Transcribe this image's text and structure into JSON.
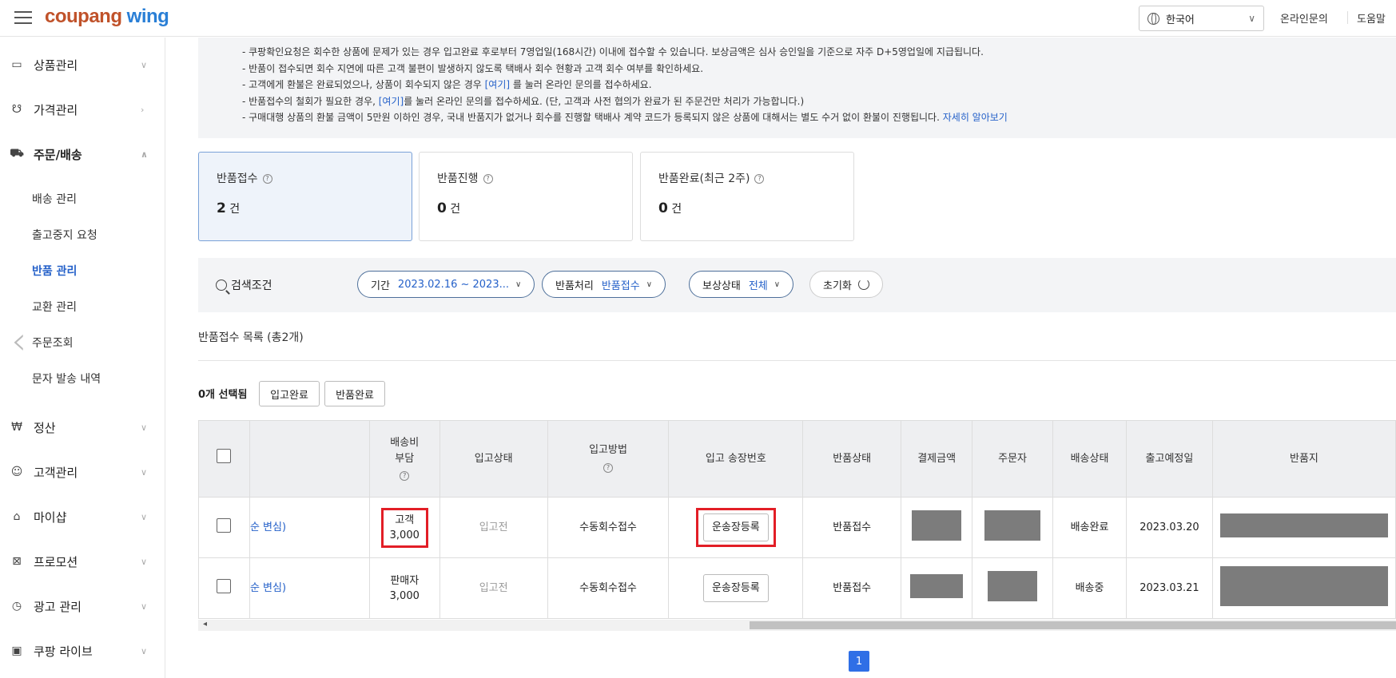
{
  "header": {
    "logo_part1": "coupang",
    "logo_part2": "wing",
    "language": "한국어",
    "online_inquiry": "온라인문의",
    "help": "도움말"
  },
  "sidebar": {
    "items": [
      {
        "label": "상품관리",
        "icon": "box-icon"
      },
      {
        "label": "가격관리",
        "icon": "price-tag-icon"
      },
      {
        "label": "주문/배송",
        "icon": "truck-icon"
      },
      {
        "label": "정산",
        "icon": "won-coin-icon"
      },
      {
        "label": "고객관리",
        "icon": "smile-icon"
      },
      {
        "label": "마이샵",
        "icon": "shop-icon"
      },
      {
        "label": "프로모션",
        "icon": "coupon-icon"
      },
      {
        "label": "광고 관리",
        "icon": "clock-icon"
      },
      {
        "label": "쿠팡 라이브",
        "icon": "live-icon"
      }
    ],
    "sub_items": [
      "배송 관리",
      "출고중지 요청",
      "반품 관리",
      "교환 관리",
      "주문조회",
      "문자 발송 내역"
    ]
  },
  "notice": {
    "line1": "- 쿠팡확인요청은 회수한 상품에 문제가 있는 경우 입고완료 후로부터 7영업일(168시간) 이내에 접수할 수 있습니다. 보상금액은 심사 승인일을 기준으로 자주 D+5영업일에 지급됩니다.",
    "line2": "- 반품이 접수되면 회수 지연에 따른 고객 불편이 발생하지 않도록 택배사 회수 현황과 고객 회수 여부를 확인하세요.",
    "line3a": "- 고객에게 환불은 완료되었으나, 상품이 회수되지 않은 경우 ",
    "line3link": "[여기]",
    "line3b": " 를 눌러 온라인 문의를 접수하세요.",
    "line4a": "- 반품접수의 철회가 필요한 경우, ",
    "line4link": "[여기]",
    "line4b": "를 눌러 온라인 문의를 접수하세요. (단, 고객과 사전 협의가 완료가 된 주문건만 처리가 가능합니다.)",
    "line5a": "- 구매대행 상품의 환불 금액이 5만원 이하인 경우, 국내 반품지가 없거나 회수를 진행할 택배사 계약 코드가 등록되지 않은 상품에 대해서는 별도 수거 없이 환불이 진행됩니다. ",
    "line5link": "자세히 알아보기"
  },
  "cards": [
    {
      "title": "반품접수",
      "count": "2",
      "unit": "건"
    },
    {
      "title": "반품진행",
      "count": "0",
      "unit": "건"
    },
    {
      "title": "반품완료(최근 2주)",
      "count": "0",
      "unit": "건"
    }
  ],
  "search": {
    "label": "검색조건",
    "period_label": "기간",
    "period_value": "2023.02.16 ~ 2023...",
    "process_label": "반품처리",
    "process_value": "반품접수",
    "comp_label": "보상상태",
    "comp_value": "전체",
    "reset": "초기화"
  },
  "list": {
    "title": "반품접수 목록 (총2개)",
    "selected": "0개 선택됨",
    "btn_receive": "입고완료",
    "btn_return_done": "반품완료"
  },
  "table": {
    "headers": [
      "배송비부담",
      "입고상태",
      "입고방법",
      "입고 송장번호",
      "반품상태",
      "결제금액",
      "주문자",
      "배송상태",
      "출고예정일",
      "반품지"
    ],
    "rows": [
      {
        "reason": "순 변심)",
        "payer": "고객",
        "fee": "3,000",
        "in_status": "입고전",
        "in_method": "수동회수접수",
        "invoice_btn": "운송장등록",
        "return_status": "반품접수",
        "ship_status": "배송완료",
        "date": "2023.03.20"
      },
      {
        "reason": "순 변심)",
        "payer": "판매자",
        "fee": "3,000",
        "in_status": "입고전",
        "in_method": "수동회수접수",
        "invoice_btn": "운송장등록",
        "return_status": "반품접수",
        "ship_status": "배송중",
        "date": "2023.03.21"
      }
    ]
  },
  "pagination": {
    "current": "1"
  }
}
